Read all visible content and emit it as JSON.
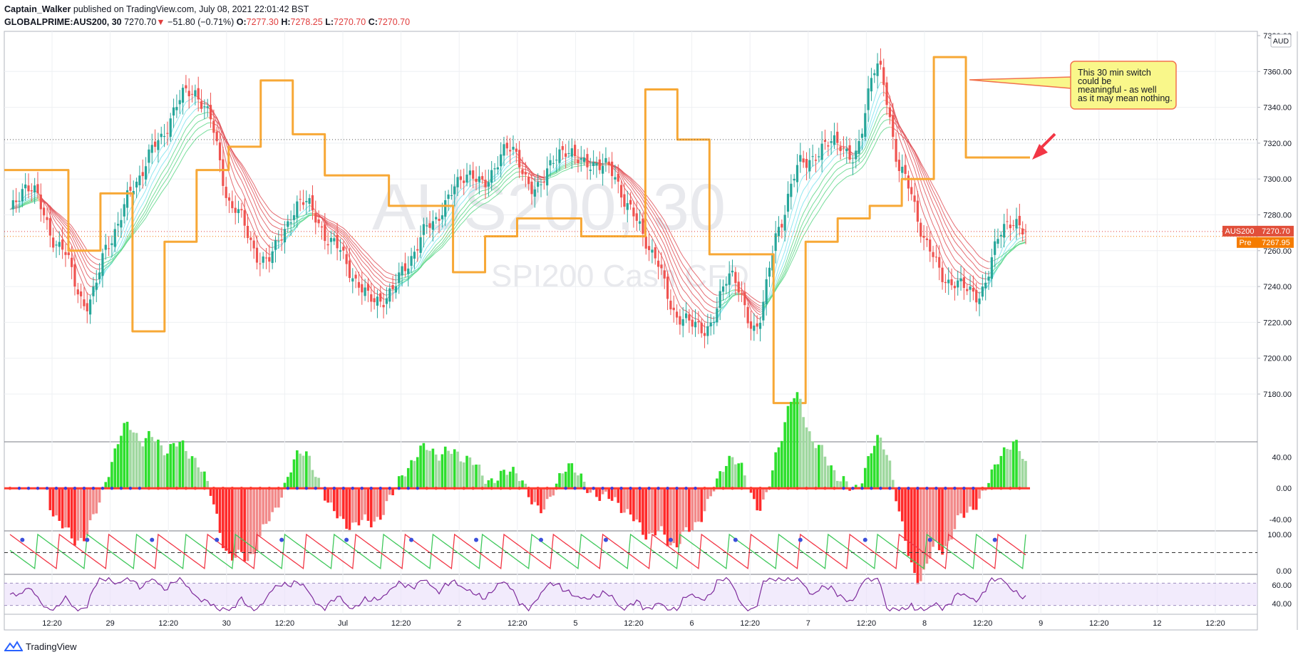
{
  "header": {
    "author": "Captain_Walker",
    "published": "published on TradingView.com, July 08, 2021 22:01:42 BST",
    "symbol": "GLOBALPRIME:AUS200, 30",
    "last": "7270.70",
    "arrow": "▼",
    "change": "−51.80 (−0.71%)",
    "o_label": "O:",
    "o": "7277.30",
    "h_label": "H:",
    "h": "7278.25",
    "l_label": "L:",
    "l": "7270.70",
    "c_label": "C:",
    "c": "7270.70"
  },
  "watermark": {
    "symbol": "AUS200, 30",
    "name": "SPI200 Cash CFD"
  },
  "price_axis": {
    "currency": "AUD",
    "ticks": [
      "7380.00",
      "7360.00",
      "7340.00",
      "7320.00",
      "7300.00",
      "7280.00",
      "7260.00",
      "7240.00",
      "7220.00",
      "7200.00",
      "7180.00"
    ],
    "last_badge": {
      "label": "AUS200",
      "value": "7270.70"
    },
    "pre_badge": {
      "label": "Pre",
      "value": "7267.95"
    }
  },
  "osc_axis": {
    "ticks": [
      "40.00",
      "0.00",
      "-40.00"
    ]
  },
  "stoch_axis": {
    "ticks": [
      "100.00",
      "0.00"
    ]
  },
  "rsi_axis": {
    "ticks": [
      "60.00",
      "40.00"
    ]
  },
  "time_axis": {
    "labels": [
      "12:20",
      "29",
      "12:20",
      "30",
      "12:20",
      "Jul",
      "12:20",
      "2",
      "12:20",
      "5",
      "12:20",
      "6",
      "12:20",
      "7",
      "12:20",
      "8",
      "12:20",
      "9",
      "12:20",
      "12",
      "12:20"
    ]
  },
  "annotation": {
    "text": "This 30 min switch could be meaningful - as well as it may mean nothing."
  },
  "footer": {
    "brand": "TradingView"
  },
  "chart_data": {
    "type": "candlestick",
    "symbol": "AUS200",
    "interval": "30",
    "currency": "AUD",
    "ylim": [
      7170,
      7385
    ],
    "day_labels": [
      "29",
      "30",
      "Jul",
      "2",
      "5",
      "6",
      "7",
      "8",
      "9",
      "12"
    ],
    "price_anchors": [
      7283,
      7295,
      7260,
      7232,
      7260,
      7300,
      7318,
      7352,
      7335,
      7285,
      7255,
      7268,
      7290,
      7262,
      7245,
      7227,
      7255,
      7272,
      7300,
      7297,
      7318,
      7296,
      7310,
      7314,
      7305,
      7288,
      7253,
      7225,
      7212,
      7248,
      7215,
      7270,
      7312,
      7318,
      7315,
      7360,
      7308,
      7260,
      7244,
      7232,
      7272,
      7270.7
    ],
    "orange_stepline": [
      7305,
      7305,
      7260,
      7292,
      7215,
      7265,
      7305,
      7318,
      7355,
      7325,
      7302,
      7302,
      7285,
      7285,
      7248,
      7268,
      7278,
      7278,
      7268,
      7268,
      7350,
      7322,
      7258,
      7258,
      7175,
      7265,
      7278,
      7285,
      7300,
      7368,
      7312,
      7312
    ],
    "last_price": 7270.7,
    "pre_price": 7267.95,
    "osc_range": [
      -50,
      55
    ],
    "stoch_range": [
      0,
      100
    ],
    "rsi_range": [
      30,
      70
    ],
    "hline_price": 7322
  }
}
